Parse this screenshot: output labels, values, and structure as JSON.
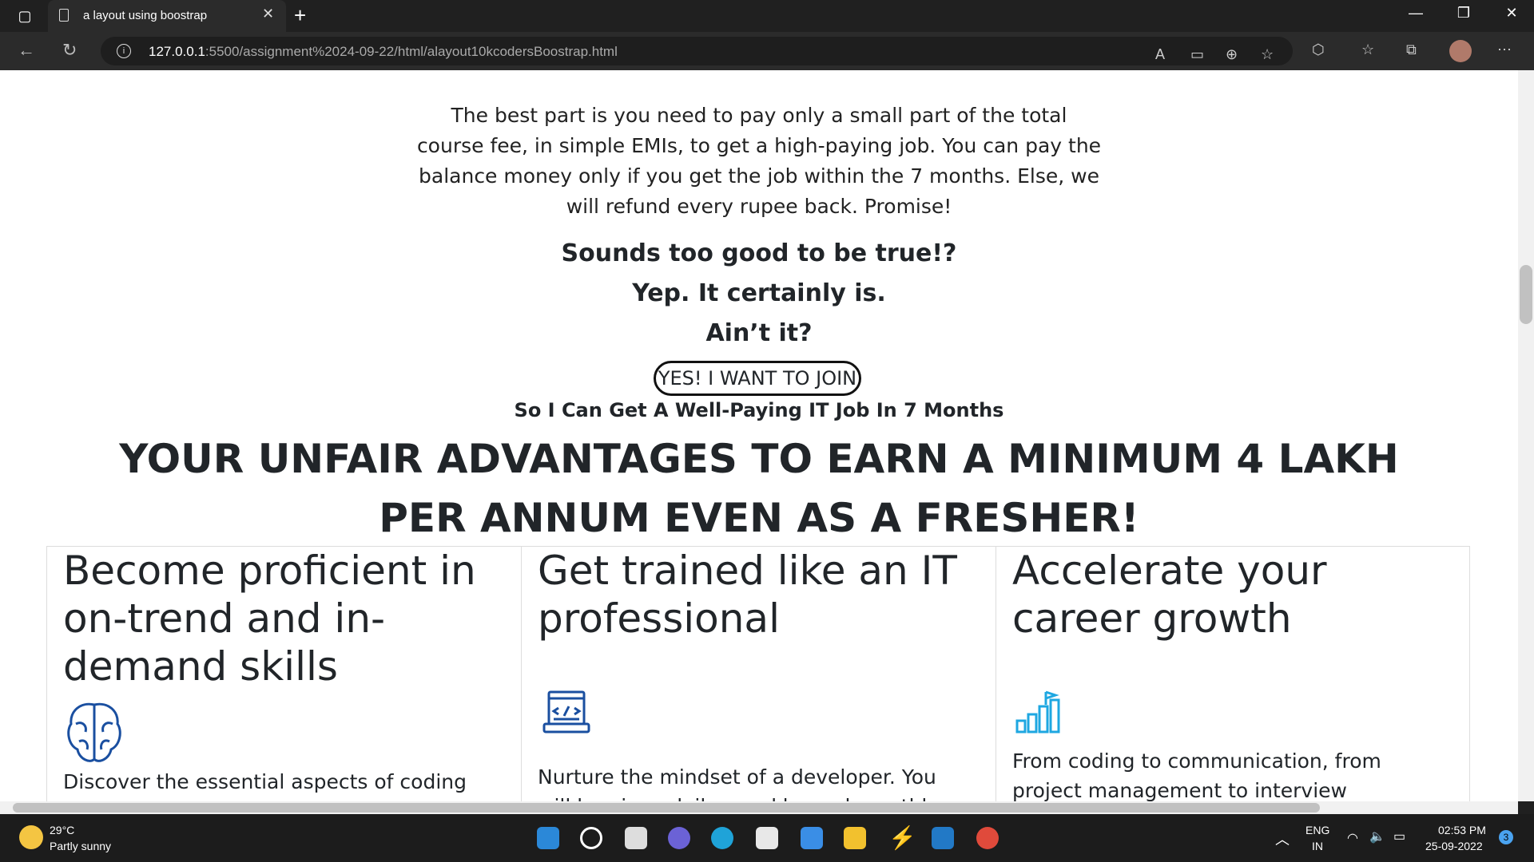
{
  "browser": {
    "tab_title": "a layout using boostrap",
    "tab_close": "✕",
    "new_tab": "+",
    "url_host": "127.0.0.1",
    "url_path": ":5500/assignment%2024-09-22/html/alayout10kcodersBoostrap.html"
  },
  "content": {
    "para": "The best part is you need to pay only a small part of the total course fee, in simple EMIs, to get a high-paying job. You can pay the balance money only if you get the job within the 7 months. Else, we will refund every rupee back. Promise!",
    "line1": "Sounds too good to be true!?",
    "line2": "Yep. It certainly is.",
    "line3": "Ain’t it?",
    "join_button": "YES! I WANT TO JOIN",
    "join_sub": "So I Can Get A Well-Paying IT Job In 7 Months",
    "big_heading": "YOUR UNFAIR ADVANTAGES TO EARN A MINIMUM 4 LAKH PER ANNUM EVEN AS A FRESHER!",
    "cards": [
      {
        "title": "Become proficient in on-trend and in-demand skills",
        "icon": "brain-icon",
        "text": "Discover the essential aspects of coding and"
      },
      {
        "title": "Get trained like an IT professional",
        "icon": "code-laptop-icon",
        "text": "Nurture the mindset of a developer. You will be given daily, weekly, and monthly product building"
      },
      {
        "title": "Accelerate your career growth",
        "icon": "growth-chart-icon",
        "text": "From coding to communication, from project management to interview attending skills, you will"
      }
    ]
  },
  "taskbar": {
    "temp": "29°C",
    "weather": "Partly sunny",
    "lang1": "ENG",
    "lang2": "IN",
    "time": "02:53 PM",
    "date": "25-09-2022",
    "badge": "3"
  },
  "colors": {
    "icon_blue": "#1a4fa0",
    "icon_cyan": "#1ea7e1"
  }
}
